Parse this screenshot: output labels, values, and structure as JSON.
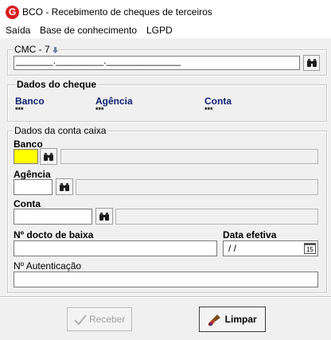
{
  "window": {
    "title": "BCO - Recebimento de cheques de terceiros",
    "app_icon_letter": "G"
  },
  "menu": {
    "items": [
      "Saída",
      "Base de conhecimento",
      "LGPD"
    ]
  },
  "cmc7": {
    "legend": "CMC - 7",
    "value": "_______._________.______________"
  },
  "dados_cheque": {
    "legend": "Dados do cheque",
    "banco_label": "Banco",
    "banco_value": "***",
    "agencia_label": "Agência",
    "agencia_value": "***",
    "conta_label": "Conta",
    "conta_value": "***"
  },
  "conta_caixa": {
    "legend": "Dados da conta caixa",
    "banco_label": "Banco",
    "agencia_label": "Agência",
    "conta_label": "Conta",
    "docto_label": "Nº docto de baixa",
    "data_label": "Data efetiva",
    "data_value": " / /",
    "calendar_day": "15",
    "autenticacao_label": "Nº Autenticação"
  },
  "buttons": {
    "receber": "Receber",
    "limpar": "Limpar"
  },
  "colors": {
    "active_field": "#ffff00",
    "label_blue": "#0d1f6e",
    "brand_red": "#d81e1e"
  }
}
